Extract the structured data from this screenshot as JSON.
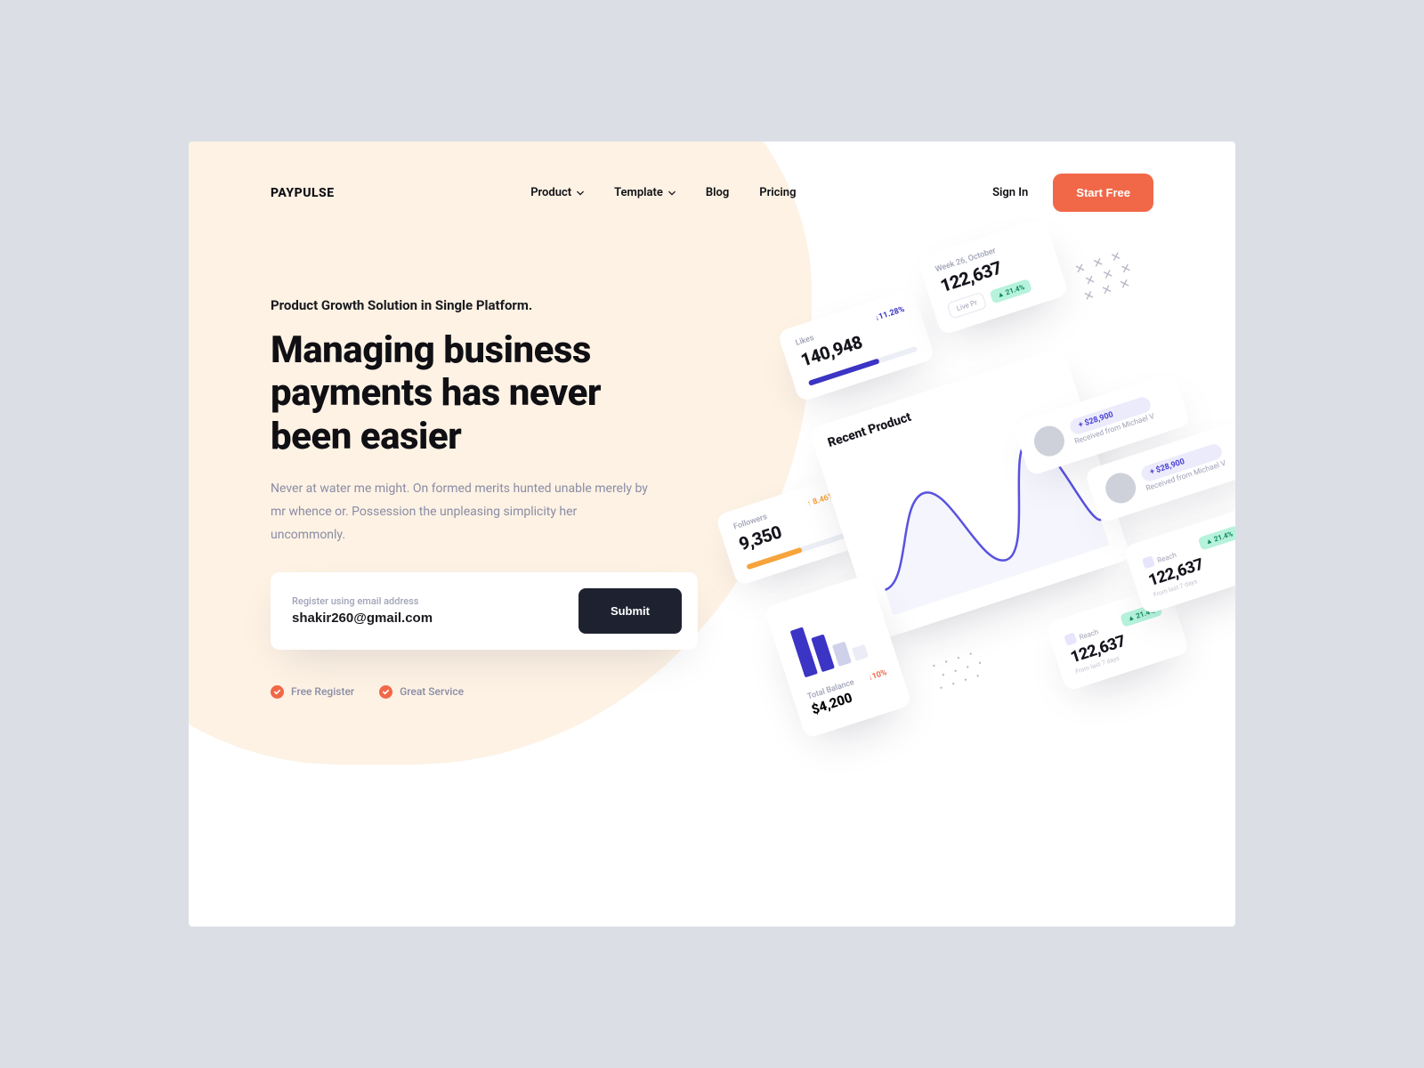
{
  "brand": "PAYPULSE",
  "nav": {
    "items": [
      {
        "label": "Product",
        "dropdown": true
      },
      {
        "label": "Template",
        "dropdown": true
      },
      {
        "label": "Blog",
        "dropdown": false
      },
      {
        "label": "Pricing",
        "dropdown": false
      }
    ]
  },
  "actions": {
    "signin": "Sign In",
    "cta": "Start Free"
  },
  "hero": {
    "eyebrow": "Product Growth Solution in Single Platform.",
    "headline": "Managing business payments has never been easier",
    "sub": "Never at water me might. On formed merits hunted unable merely by mr whence or. Possession the unpleasing simplicity her uncommonly.",
    "email_label": "Register using email address",
    "email_value": "shakir260@gmail.com",
    "submit": "Submit",
    "badges": [
      "Free Register",
      "Great Service"
    ]
  },
  "illus": {
    "likes": {
      "caption": "Likes",
      "value": "140,948",
      "change": "↓11.28%"
    },
    "stat_top": {
      "caption": "Week 26, October",
      "value": "122,637",
      "pill": "21.4%",
      "livepr": "Live Pr"
    },
    "followers": {
      "caption": "Followers",
      "value": "9,350",
      "change": "↑ 8.46%"
    },
    "recent": {
      "title": "Recent Product"
    },
    "balance": {
      "caption": "Total Balance",
      "value": "$4,200",
      "change": "10%"
    },
    "received": {
      "amount": "+ $28,900",
      "text": "Received from Michael V"
    },
    "reach": {
      "label": "Reach",
      "value": "122,637",
      "foot": "From last 7 days",
      "pill": "21.4%"
    }
  },
  "colors": {
    "accent": "#f16848",
    "indigo": "#3b34c4",
    "amber": "#f6a43b",
    "mint": "#b6f2dc"
  }
}
